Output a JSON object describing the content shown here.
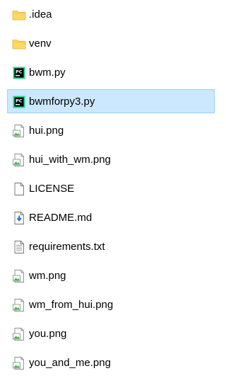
{
  "colors": {
    "selected_background": "#cce8ff",
    "selected_border": "#99d1ff",
    "folder": "#ffd764",
    "pycharm_green": "#21d789",
    "readme_blue": "#2b78d4"
  },
  "files": [
    {
      "name": ".idea",
      "icon": "folder-icon",
      "selected": false
    },
    {
      "name": "venv",
      "icon": "folder-icon",
      "selected": false
    },
    {
      "name": "bwm.py",
      "icon": "pycharm-file-icon",
      "selected": false
    },
    {
      "name": "bwmforpy3.py",
      "icon": "pycharm-file-icon",
      "selected": true
    },
    {
      "name": "hui.png",
      "icon": "image-file-icon",
      "selected": false
    },
    {
      "name": "hui_with_wm.png",
      "icon": "image-file-icon",
      "selected": false
    },
    {
      "name": "LICENSE",
      "icon": "blank-file-icon",
      "selected": false
    },
    {
      "name": "README.md",
      "icon": "markdown-file-icon",
      "selected": false
    },
    {
      "name": "requirements.txt",
      "icon": "text-file-icon",
      "selected": false
    },
    {
      "name": "wm.png",
      "icon": "image-file-icon",
      "selected": false
    },
    {
      "name": "wm_from_hui.png",
      "icon": "image-file-icon",
      "selected": false
    },
    {
      "name": "you.png",
      "icon": "image-file-icon",
      "selected": false
    },
    {
      "name": "you_and_me.png",
      "icon": "image-file-icon",
      "selected": false
    }
  ]
}
